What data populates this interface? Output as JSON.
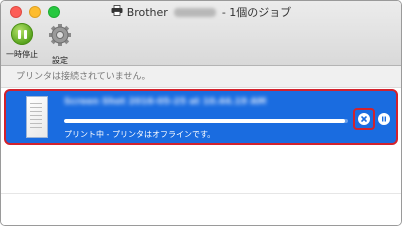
{
  "window": {
    "app_name": "Brother",
    "title_suffix": "- 1個のジョブ"
  },
  "toolbar": {
    "pause_label": "一時停止",
    "settings_label": "設定"
  },
  "status": {
    "message": "プリンタは接続されていません。"
  },
  "job": {
    "name": "Screen Shot 2016-05-25 at 10.44.19 AM",
    "status": "プリント中 - プリンタはオフラインです。",
    "progress": 0.99
  },
  "colors": {
    "selection": "#1a6ce0",
    "highlight": "#d2222d",
    "pause_green": "#5aa51f"
  },
  "icons": {
    "printer": "printer-icon",
    "pause": "pause-icon",
    "settings": "gear-icon",
    "cancel": "close-circle-icon",
    "job_pause": "pause-circle-icon",
    "document": "document-icon"
  }
}
